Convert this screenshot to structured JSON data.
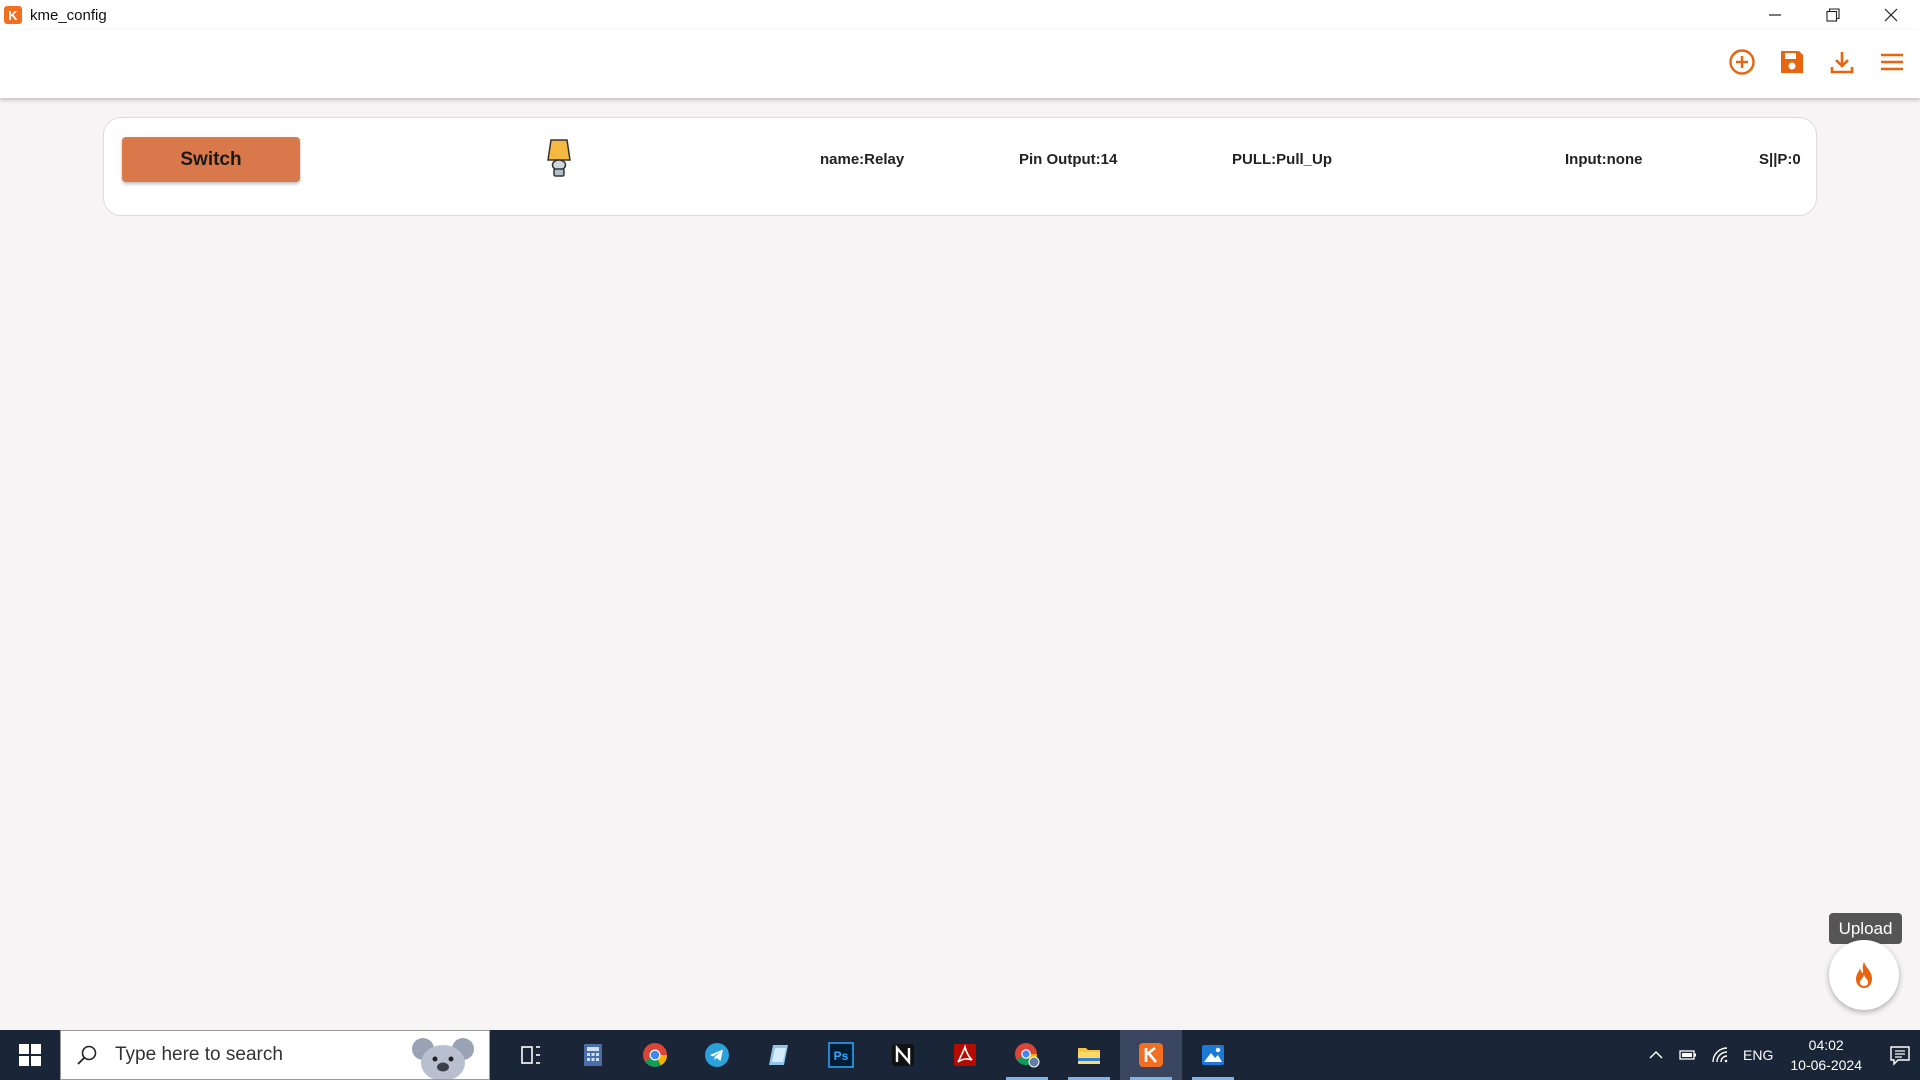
{
  "window": {
    "title": "kme_config",
    "logo_letter": "K"
  },
  "toolbar": {
    "icons": [
      "add-circle-icon",
      "save-icon",
      "download-icon",
      "menu-icon"
    ],
    "accent": "#e8650f"
  },
  "device": {
    "button_label": "Switch",
    "icon": "lamp-icon",
    "name": "name:Relay",
    "pin_output": "Pin Output:14",
    "pull": "PULL:Pull_Up",
    "input": "Input:none",
    "sip": "S||P:0",
    "button_color": "#d9784a"
  },
  "upload": {
    "tooltip": "Upload",
    "icon": "flame-icon"
  },
  "taskbar": {
    "search_placeholder": "Type here to search",
    "apps": [
      "task-view-icon",
      "calculator-icon",
      "chrome-icon",
      "telegram-icon",
      "notepad-icon",
      "photoshop-icon",
      "notion-icon",
      "acrobat-icon",
      "chrome-profile-icon",
      "file-explorer-icon",
      "kme-config-icon",
      "photos-icon"
    ],
    "tray": {
      "language": "ENG",
      "time": "04:02",
      "date": "10-06-2024"
    },
    "background": "#1b2538"
  }
}
